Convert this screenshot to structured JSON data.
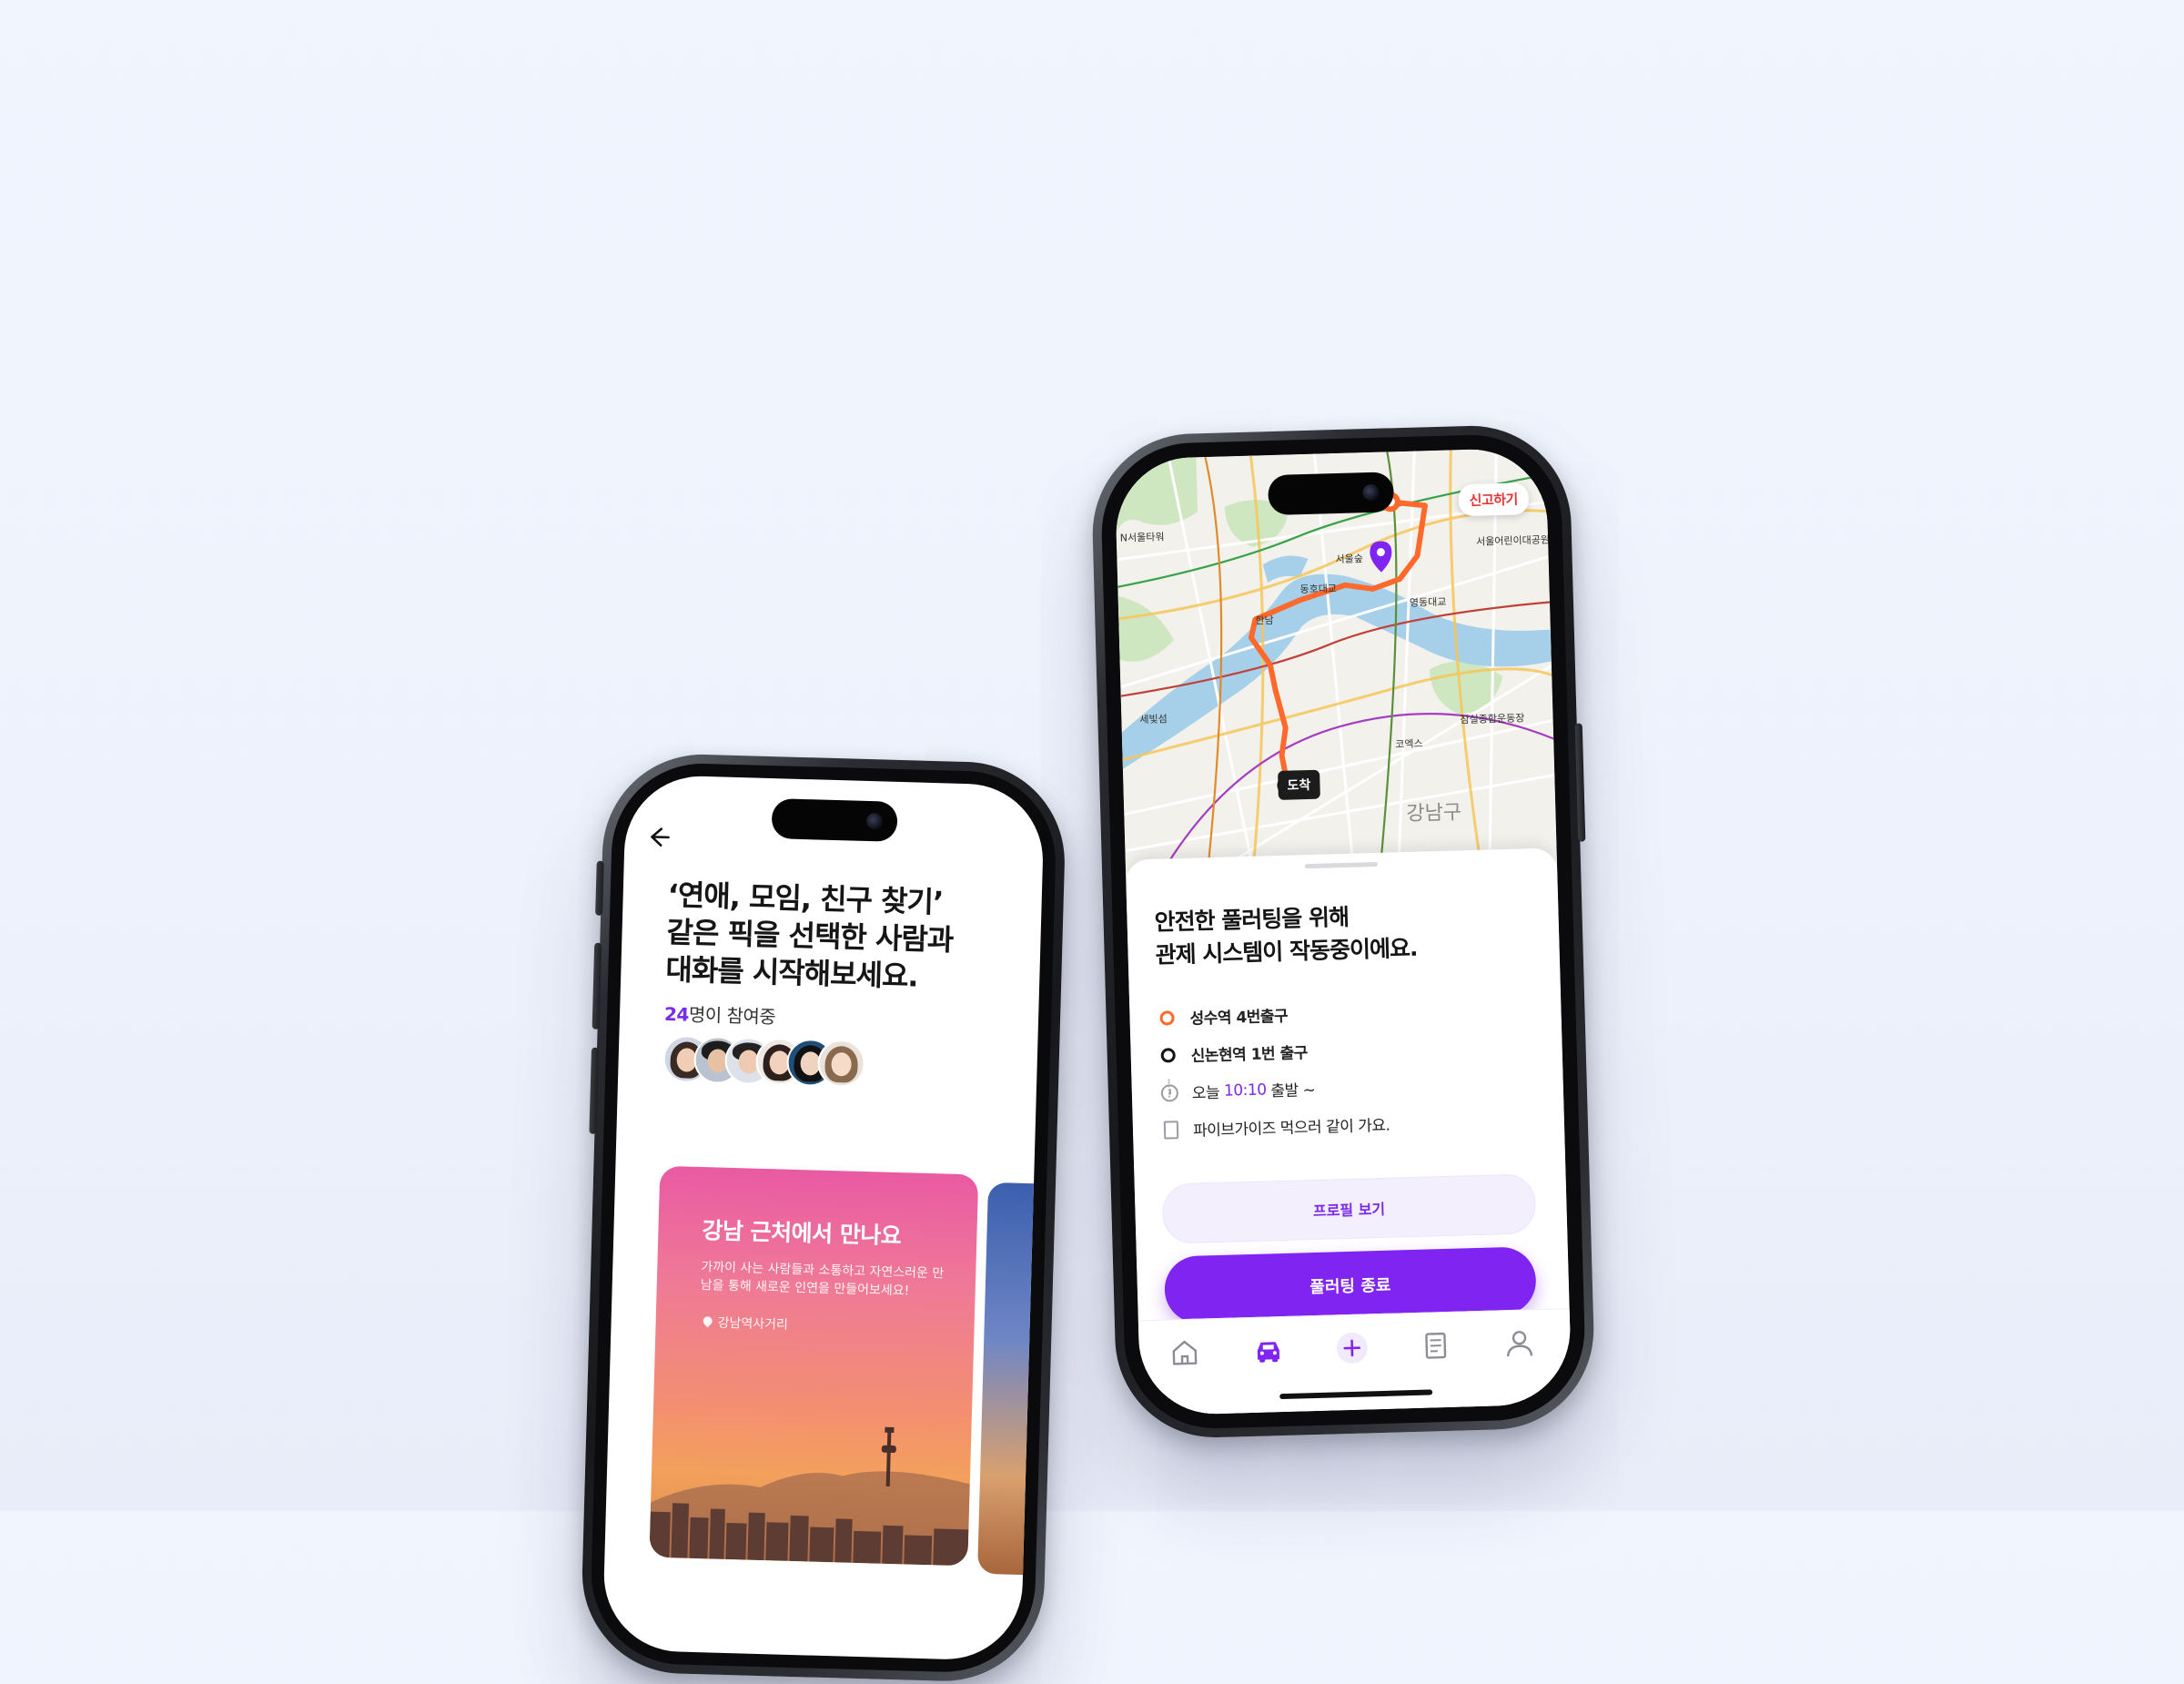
{
  "left_phone": {
    "back_icon": "back-arrow-icon",
    "headline": "‘연애, 모임, 친구 찾기’ 같은 픽을 선택한 사람과 대화를 시작해보세요.",
    "headline_lines": [
      "‘연애, 모임, 친구 찾기’",
      "같은 픽을 선택한 사람과",
      "대화를 시작해보세요."
    ],
    "participants_count": "24",
    "participants_suffix": "명이 참여중",
    "avatars": 6,
    "card": {
      "title": "강남 근처에서 만나요",
      "description": "가까이 사는 사람들과 소통하고 자연스러운 만남을 통해 새로운 인연을 만들어보세요!",
      "location": "강남역사거리"
    }
  },
  "right_phone": {
    "report_button": "신고하기",
    "map_labels": {
      "arrive_tag": "도착",
      "district": "강남구",
      "place_1": "서울숲",
      "place_2": "한남",
      "place_3": "동호대교",
      "place_4": "영동대교",
      "place_5": "코엑스",
      "place_6": "잠실종합운동장",
      "place_7": "세빛섬",
      "place_8": "서울어린이대공원",
      "place_9": "N서울타워"
    },
    "headline_lines": [
      "안전한 풀러팅을 위해",
      "관제 시스템이 작동중이에요."
    ],
    "route": {
      "from": "성수역 4번출구",
      "to": "신논현역 1번 출구",
      "time_prefix": "오늘",
      "time": "10:10",
      "time_suffix": "출발 ~",
      "memo": "파이브가이즈 먹으러 같이 가요."
    },
    "profile_button": "프로필 보기",
    "end_button": "풀러팅 종료",
    "tabs": [
      "home-icon",
      "car-icon",
      "plus-icon",
      "document-icon",
      "person-icon"
    ],
    "active_tab": "car-icon"
  },
  "colors": {
    "accent": "#7f24f1",
    "route": "#ff6a2c",
    "report": "#e33636",
    "background": "#eef2fc"
  }
}
